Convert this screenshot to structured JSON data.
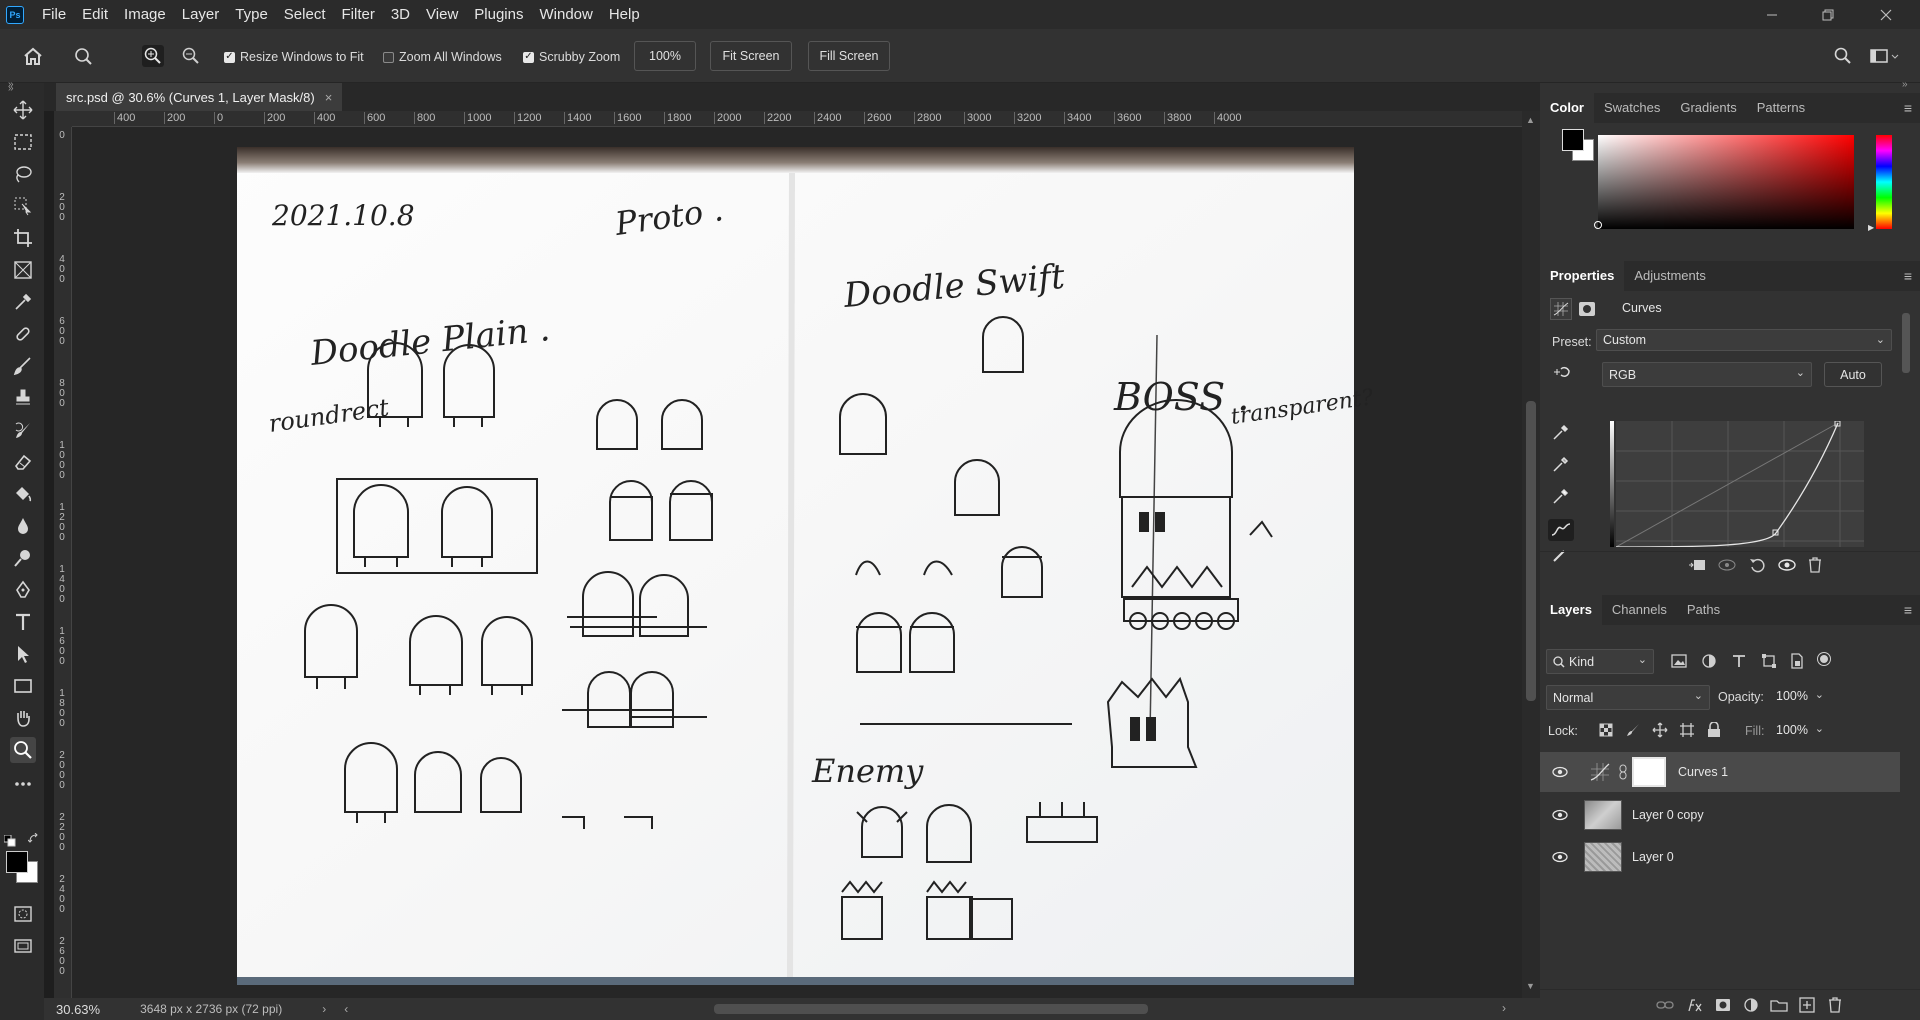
{
  "app": {
    "logo": "Ps",
    "menu": [
      "File",
      "Edit",
      "Image",
      "Layer",
      "Type",
      "Select",
      "Filter",
      "3D",
      "View",
      "Plugins",
      "Window",
      "Help"
    ]
  },
  "options": {
    "resize_windows": "Resize Windows to Fit",
    "zoom_all": "Zoom All Windows",
    "scrubby_zoom": "Scrubby Zoom",
    "zoom_value": "100%",
    "fit_screen": "Fit Screen",
    "fill_screen": "Fill Screen"
  },
  "document": {
    "tab_title": "src.psd @ 30.6% (Curves 1, Layer Mask/8)",
    "zoom": "30.63%",
    "size_info": "3648 px x 2736 px (72 ppi)"
  },
  "rulers": {
    "h_labels": [
      "400",
      "200",
      "0",
      "200",
      "400",
      "600",
      "800",
      "1000",
      "1200",
      "1400",
      "1600",
      "1800",
      "2000",
      "2200",
      "2400",
      "2600",
      "2800",
      "3000",
      "3200",
      "3400",
      "3600",
      "3800",
      "4000"
    ],
    "v_labels": [
      "0",
      "200",
      "400",
      "600",
      "800",
      "1000",
      "1200",
      "1400",
      "1600",
      "1800",
      "2000",
      "2200",
      "2400",
      "2600"
    ]
  },
  "sketch": {
    "date": "2021.10.8",
    "proto": "Proto .",
    "doodle_plain": "Doodle Plain .",
    "roundrect": "roundrect",
    "doodle_swift": "Doodle Swift",
    "boss": "BOSS .",
    "transparent": "transparent?",
    "enemy": "Enemy"
  },
  "color_panel": {
    "tabs": [
      "Color",
      "Swatches",
      "Gradients",
      "Patterns"
    ],
    "active": "Color"
  },
  "properties": {
    "tabs": [
      "Properties",
      "Adjustments"
    ],
    "type_label": "Curves",
    "preset_label": "Preset:",
    "preset_value": "Custom",
    "channel": "RGB",
    "auto_button": "Auto"
  },
  "layers_panel": {
    "tabs": [
      "Layers",
      "Channels",
      "Paths"
    ],
    "kind": "Kind",
    "blend_mode": "Normal",
    "opacity_label": "Opacity:",
    "opacity_value": "100%",
    "lock_label": "Lock:",
    "fill_label": "Fill:",
    "fill_value": "100%",
    "layers": [
      {
        "name": "Curves 1",
        "selected": true
      },
      {
        "name": "Layer 0 copy",
        "selected": false
      },
      {
        "name": "Layer 0",
        "selected": false
      }
    ]
  },
  "colors": {
    "accent": "#31a8ff",
    "panel_bg": "#323232",
    "selected_layer": "#4a4a4a"
  }
}
